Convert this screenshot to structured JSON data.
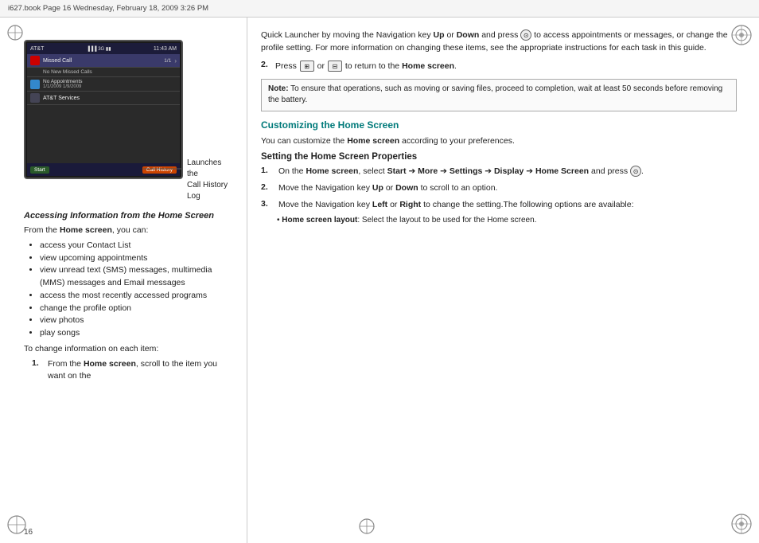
{
  "topbar": {
    "text": "i627.book  Page 16  Wednesday, February 18, 2009  3:26 PM"
  },
  "left": {
    "callout_text": "Launches the\nCall History Log",
    "accessing_heading": "Accessing Information from the Home Screen",
    "body1": "From the ",
    "body1_bold": "Home screen",
    "body1_end": ", you can:",
    "bullets": [
      "access your Contact List",
      "view upcoming appointments",
      "view unread text (SMS) messages, multimedia (MMS) messages and Email messages",
      "access the most recently accessed programs",
      "change the profile option",
      "view photos",
      "play songs"
    ],
    "to_change": "To change information on each item:",
    "step1_num": "1.",
    "step1_text": "From the ",
    "step1_bold": "Home screen",
    "step1_end": ", scroll to the item you want on the"
  },
  "right": {
    "para1": "Quick Launcher by moving the Navigation key ",
    "para1_up": "Up",
    "para1_or": " or ",
    "para1_down": "Down",
    "para1_end": " and press   to access appointments or messages, or change the profile setting. For more information on changing these items, see the appropriate instructions for each task in this guide.",
    "step2_num": "2.",
    "step2_text": "Press",
    "step2_mid": " or ",
    "step2_end": " to return to the ",
    "step2_bold": "Home screen",
    "step2_period": ".",
    "note_label": "Note:",
    "note_text": " To ensure that operations, such as moving or saving files, proceed to completion, wait at least 50 seconds before removing the battery.",
    "customizing_heading": "Customizing the Home Screen",
    "customizing_body1": "You can customize the ",
    "customizing_body1_bold": "Home screen",
    "customizing_body1_end": " according to your preferences.",
    "setting_heading": "Setting the Home Screen Properties",
    "s1_num": "1.",
    "s1_text": "On the ",
    "s1_home": "Home screen",
    "s1_select": ", select ",
    "s1_start": "Start",
    "s1_arr1": " ➔ ",
    "s1_more": "More",
    "s1_arr2": " ➔ ",
    "s1_settings": "Settings",
    "s1_arr3": " ➔ ",
    "s1_display": "Display",
    "s1_arr4": " ➔ ",
    "s1_homescreen": "Home Screen",
    "s1_end": " and press   .",
    "s2_num": "2.",
    "s2_text": "Move the Navigation key ",
    "s2_up": "Up",
    "s2_or": " or ",
    "s2_down": "Down",
    "s2_end": " to scroll to an option.",
    "s3_num": "3.",
    "s3_text": "Move the Navigation key ",
    "s3_left": "Left",
    "s3_or": " or ",
    "s3_right": "Right",
    "s3_end": " to change the setting.The following options are available:",
    "subbullet_bold": "Home screen layout",
    "subbullet_end": ": Select the layout to be used for the Home screen."
  },
  "page_num": "16",
  "phone": {
    "carrier": "AT&T",
    "signal": "3G",
    "time": "11:43 AM",
    "missed_call": "Missed Call",
    "missed_count": "1/1",
    "no_missed": "No New Missed Calls",
    "appt": "No Appointments",
    "appt_date": "1/1/2009  1/9/2009",
    "att_services": "AT&T Services",
    "start": "Start",
    "call_history": "Call History"
  }
}
